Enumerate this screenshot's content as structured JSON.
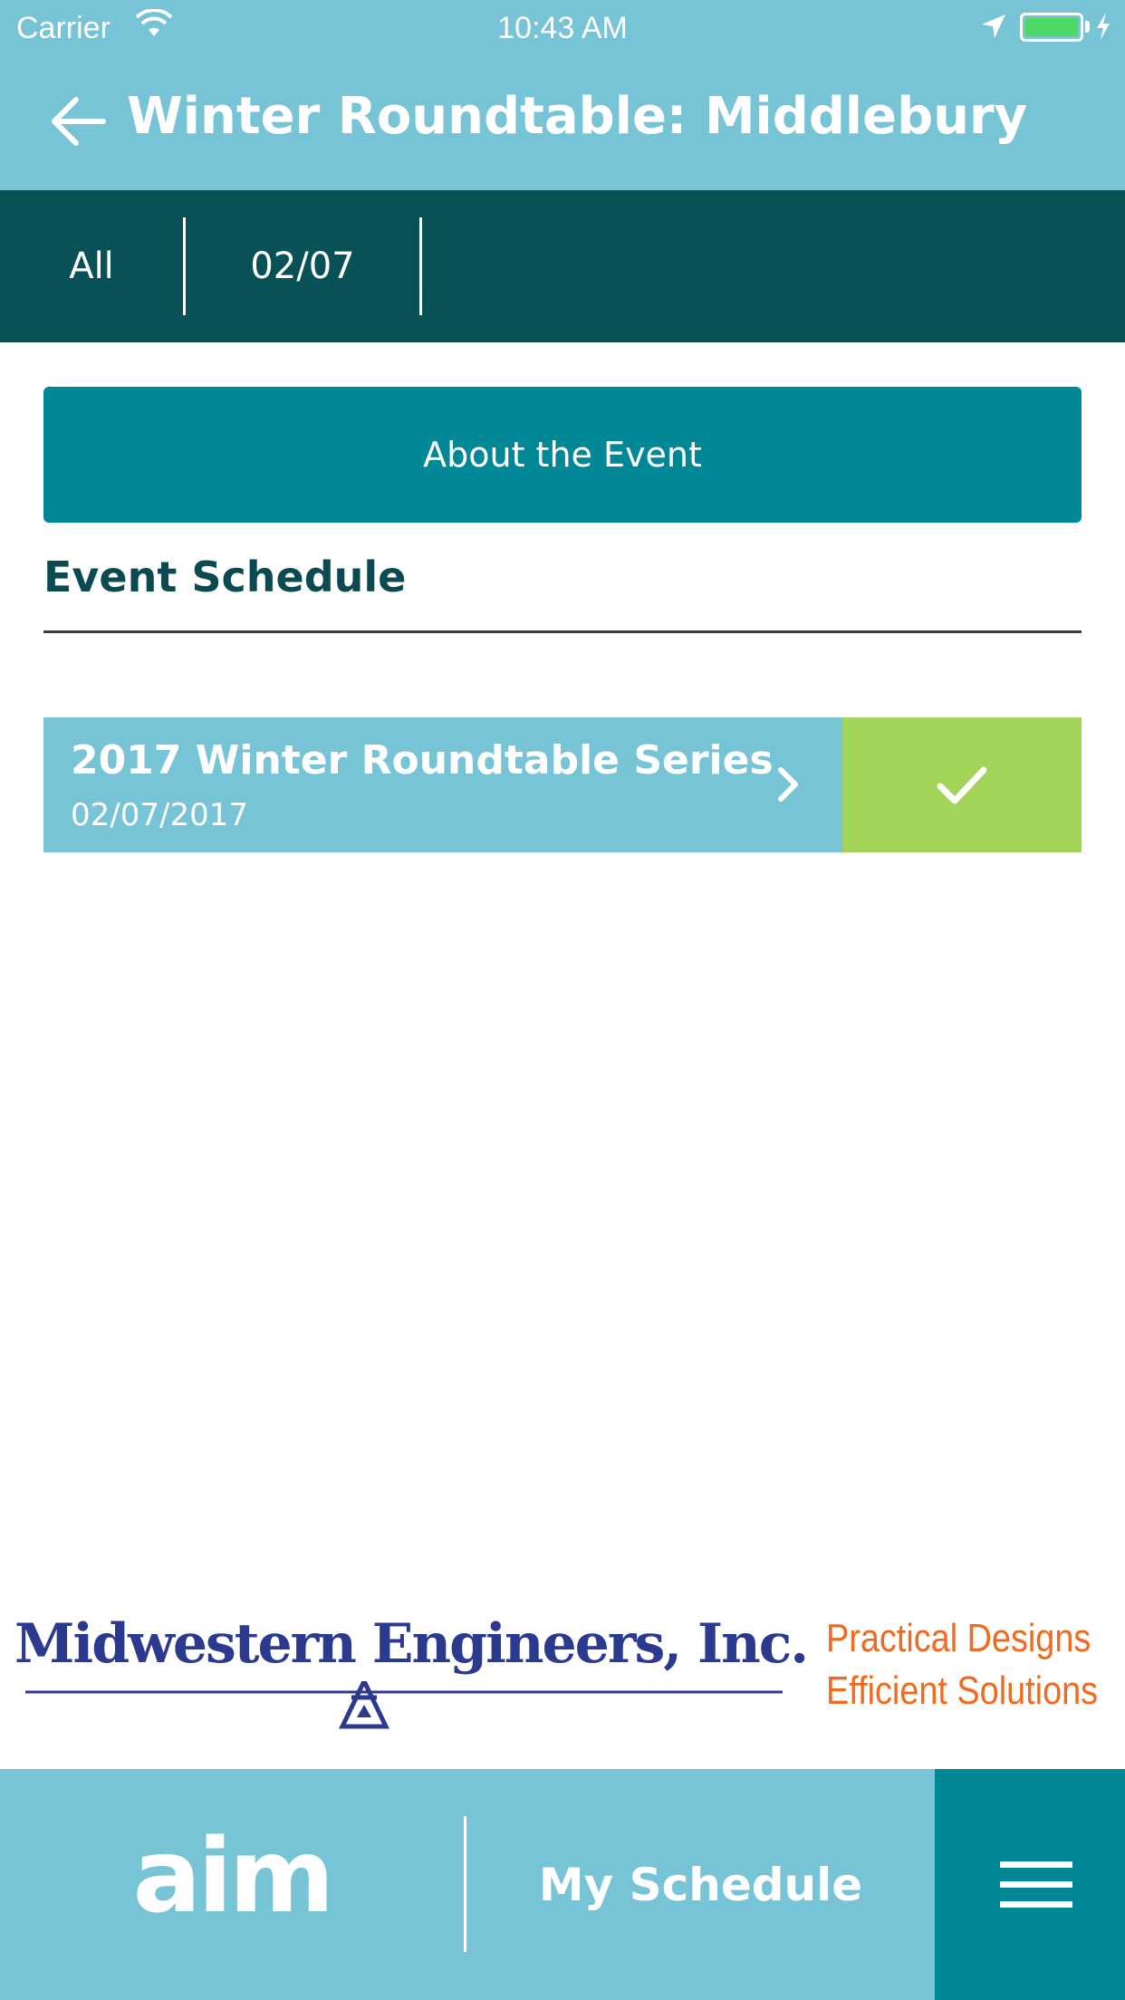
{
  "status_bar": {
    "carrier": "Carrier",
    "time": "10:43 AM",
    "battery_level": 1.0
  },
  "header": {
    "title": "Winter Roundtable: Middlebury",
    "back_icon": "arrow-left-icon"
  },
  "tabs": [
    {
      "label": "All"
    },
    {
      "label": "02/07"
    }
  ],
  "about_button": {
    "label": "About the Event"
  },
  "schedule": {
    "heading": "Event Schedule",
    "events": [
      {
        "title": "2017 Winter Roundtable Series",
        "date": "02/07/2017",
        "added": true
      }
    ]
  },
  "sponsor": {
    "name": "Midwestern Engineers, Inc.",
    "tagline_line1": "Practical Designs",
    "tagline_line2": "Efficient Solutions"
  },
  "bottom_bar": {
    "logo": "aim",
    "my_schedule_label": "My Schedule",
    "menu_icon": "hamburger-menu-icon"
  },
  "colors": {
    "header_bg": "#77c4d6",
    "tabs_bg": "#085157",
    "button_teal": "#008896",
    "heading_text": "#0b4a50",
    "check_green": "#a2d45a",
    "sponsor_blue": "#2b3a8f",
    "sponsor_orange": "#f06a1f"
  }
}
